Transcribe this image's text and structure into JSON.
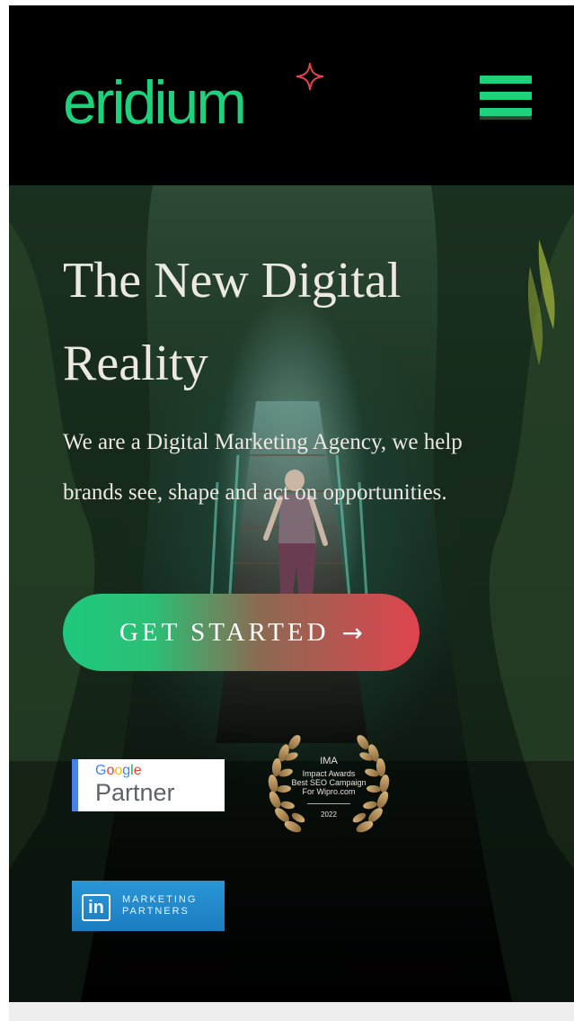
{
  "header": {
    "logo_text": "eridium",
    "menu_icon": "hamburger-menu-icon"
  },
  "hero": {
    "title": "The New Digital Reality",
    "subtitle": "We are a Digital Marketing Agency, we help brands see, shape and act on opportunities.",
    "cta_label": "GET STARTED",
    "cta_icon": "arrow-right-icon",
    "cta_arrow": "→"
  },
  "badges": {
    "google": {
      "brand": [
        "G",
        "o",
        "o",
        "g",
        "l",
        "e"
      ],
      "label": "Partner"
    },
    "ima": {
      "title": "IMA",
      "line1": "Impact Awards",
      "line2": "Best SEO Campaign",
      "line3": "For Wipro.com",
      "year": "2022"
    },
    "linkedin": {
      "logo": "in",
      "line1": "MARKETING",
      "line2": "PARTNERS"
    }
  },
  "colors": {
    "brand_green": "#1ed27c",
    "cta_start": "#1ec97e",
    "cta_end": "#e0434e",
    "google_blue": "#4285f4",
    "google_red": "#ea4335",
    "google_yellow": "#fbbc05",
    "google_green": "#34a853",
    "linkedin_blue": "#1b7dc0"
  }
}
